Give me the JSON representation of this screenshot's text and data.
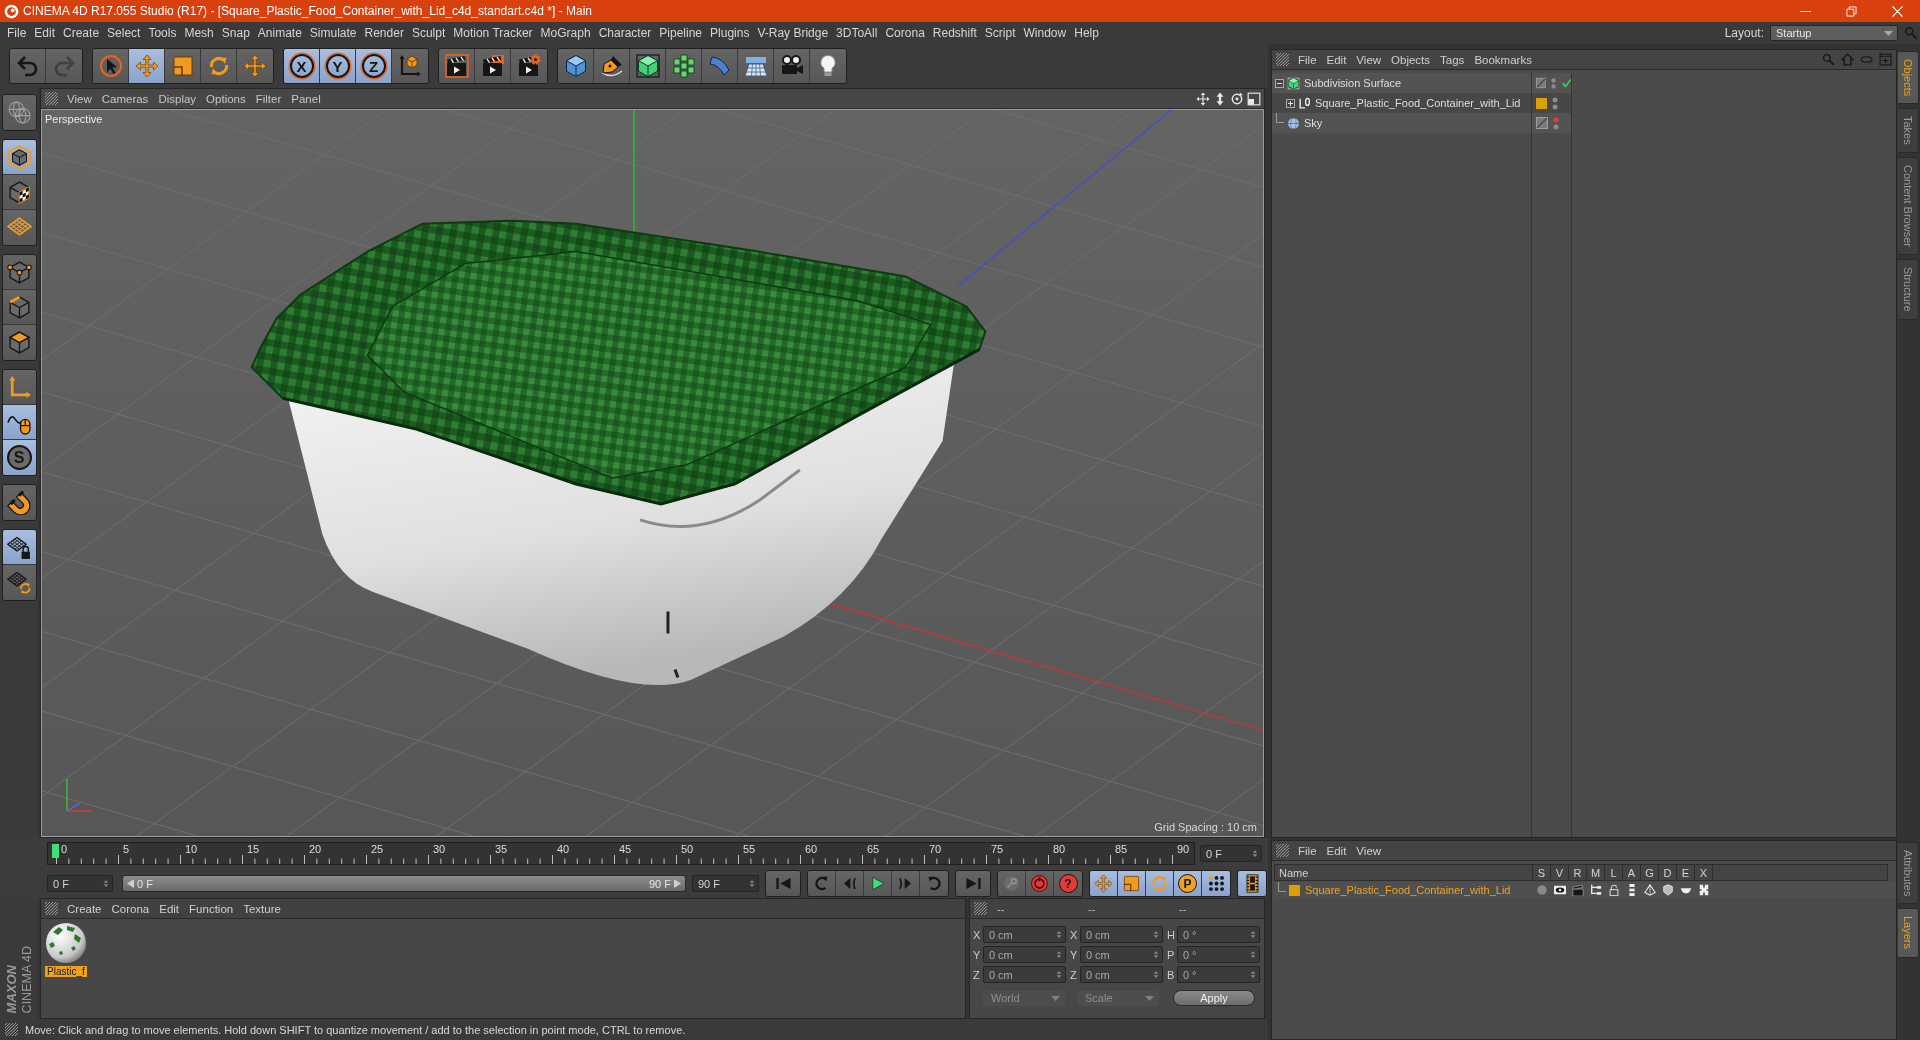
{
  "window": {
    "title": "CINEMA 4D R17.055 Studio (R17) - [Square_Plastic_Food_Container_with_Lid_c4d_standart.c4d *] - Main"
  },
  "menu_bar": {
    "items": [
      "File",
      "Edit",
      "Create",
      "Select",
      "Tools",
      "Mesh",
      "Snap",
      "Animate",
      "Simulate",
      "Render",
      "Sculpt",
      "Motion Tracker",
      "MoGraph",
      "Character",
      "Pipeline",
      "Plugins",
      "V-Ray Bridge",
      "3DToAll",
      "Corona",
      "Redshift",
      "Script",
      "Window",
      "Help"
    ],
    "layout_label": "Layout:",
    "layout_value": "Startup"
  },
  "toolbar": [
    [
      {
        "kind": "undo",
        "active": false,
        "disabled": false
      },
      {
        "kind": "redo",
        "active": false,
        "disabled": true
      }
    ],
    [
      {
        "kind": "select",
        "active": false,
        "disabled": false
      },
      {
        "kind": "move",
        "active": true,
        "disabled": false
      },
      {
        "kind": "scale",
        "active": false,
        "disabled": false
      },
      {
        "kind": "rotate",
        "active": false,
        "disabled": false
      },
      {
        "kind": "recent",
        "active": false,
        "disabled": false
      }
    ],
    [
      {
        "kind": "axis",
        "label": "X",
        "active": true,
        "disabled": false
      },
      {
        "kind": "axis",
        "label": "Y",
        "active": true,
        "disabled": false
      },
      {
        "kind": "axis",
        "label": "Z",
        "active": true,
        "disabled": false
      },
      {
        "kind": "coords",
        "active": false,
        "disabled": false
      }
    ],
    [
      {
        "kind": "render_view",
        "active": false,
        "disabled": false
      },
      {
        "kind": "render_picture",
        "active": false,
        "disabled": false
      },
      {
        "kind": "render_settings",
        "active": false,
        "disabled": false
      }
    ],
    [
      {
        "kind": "cube",
        "active": false,
        "disabled": false
      },
      {
        "kind": "pen",
        "active": false,
        "disabled": false
      },
      {
        "kind": "subdivision",
        "active": false,
        "disabled": false
      },
      {
        "kind": "cloner",
        "active": false,
        "disabled": false
      },
      {
        "kind": "bend",
        "active": false,
        "disabled": false
      },
      {
        "kind": "floor",
        "active": false,
        "disabled": false
      },
      {
        "kind": "camera",
        "active": false,
        "disabled": false
      },
      {
        "kind": "light",
        "active": false,
        "disabled": false
      }
    ]
  ],
  "mode_toolbar": [
    [
      {
        "kind": "make_editable",
        "active": false
      }
    ],
    [
      {
        "kind": "model",
        "active": true
      },
      {
        "kind": "texture",
        "active": false
      },
      {
        "kind": "workplane",
        "active": false
      }
    ],
    [
      {
        "kind": "points",
        "active": false
      },
      {
        "kind": "edges",
        "active": false
      },
      {
        "kind": "polygons",
        "active": false
      }
    ],
    [
      {
        "kind": "axis_mode",
        "active": false
      },
      {
        "kind": "tweak",
        "active": true
      },
      {
        "kind": "solo",
        "label": "S",
        "active": true
      }
    ],
    [
      {
        "kind": "snap",
        "active": false
      }
    ],
    [
      {
        "kind": "workplane_lock",
        "active": true
      },
      {
        "kind": "workplane_rotate",
        "active": false
      }
    ]
  ],
  "viewport": {
    "menu": [
      "View",
      "Cameras",
      "Display",
      "Options",
      "Filter",
      "Panel"
    ],
    "camera": "Perspective",
    "grid_spacing": "Grid Spacing : 10 cm"
  },
  "timeline": {
    "ruler_labels": [
      "0",
      "5",
      "10",
      "15",
      "20",
      "25",
      "30",
      "35",
      "40",
      "45",
      "50",
      "55",
      "60",
      "65",
      "70",
      "75",
      "80",
      "85",
      "90"
    ],
    "playhead": {
      "level": 0
    },
    "current_frame": "0 F",
    "start_frame": "0 F",
    "range": {
      "start": "0 F",
      "end": "90 F",
      "level": 1
    },
    "end_frame": "90 F",
    "transport": [
      [
        {
          "kind": "first"
        }
      ],
      [
        {
          "kind": "prev_key"
        },
        {
          "kind": "prev_frame"
        },
        {
          "kind": "play"
        },
        {
          "kind": "next_frame"
        },
        {
          "kind": "next_key"
        }
      ],
      [
        {
          "kind": "last"
        }
      ]
    ],
    "record": [
      {
        "kind": "autokey",
        "disabled": true
      },
      {
        "kind": "record",
        "disabled": false
      },
      {
        "kind": "key_help",
        "label": "?",
        "disabled": false
      }
    ],
    "key_filters": [
      {
        "kind": "key_position",
        "active": true
      },
      {
        "kind": "key_scale",
        "active": true
      },
      {
        "kind": "key_rotation",
        "active": true
      },
      {
        "kind": "key_parameter",
        "label": "P",
        "active": true
      },
      {
        "kind": "key_pla",
        "active": true
      }
    ],
    "timeline_button": {
      "active": true
    }
  },
  "brand": {
    "maker": "MAXON",
    "product": "CINEMA 4D"
  },
  "materials": {
    "menu": [
      "Create",
      "Corona",
      "Edit",
      "Function",
      "Texture"
    ],
    "items": [
      {
        "name": "Plastic_f",
        "selected": true
      }
    ]
  },
  "coordinates": {
    "headers": [
      "--",
      "--",
      "--"
    ],
    "rows": [
      [
        {
          "label": "X",
          "value": "0 cm"
        },
        {
          "label": "X",
          "value": "0 cm"
        },
        {
          "label": "H",
          "value": "0 °"
        }
      ],
      [
        {
          "label": "Y",
          "value": "0 cm"
        },
        {
          "label": "Y",
          "value": "0 cm"
        },
        {
          "label": "P",
          "value": "0 °"
        }
      ],
      [
        {
          "label": "Z",
          "value": "0 cm"
        },
        {
          "label": "Z",
          "value": "0 cm"
        },
        {
          "label": "B",
          "value": "0 °"
        }
      ]
    ],
    "dropdowns": [
      {
        "value": "World",
        "disabled": true
      },
      {
        "value": "Scale",
        "disabled": true
      }
    ],
    "apply": "Apply"
  },
  "status_bar": {
    "text": "Move: Click and drag to move elements. Hold down SHIFT to quantize movement / add to the selection in point mode, CTRL to remove."
  },
  "objects": {
    "menu": [
      "File",
      "Edit",
      "View",
      "Objects",
      "Tags",
      "Bookmarks"
    ],
    "tree": [
      {
        "name": "Subdivision Surface",
        "kind": "subdivision",
        "expanded": true,
        "hidden_in_editor": false,
        "hidden_in_render": false,
        "enabled": true,
        "children": [
          {
            "name": "Square_Plastic_Food_Container_with_Lid",
            "kind": "null",
            "expanded": false,
            "color": "#d9a000",
            "hidden_in_editor": false,
            "hidden_in_render": false,
            "enabled": false
          }
        ]
      },
      {
        "name": "Sky",
        "kind": "sky",
        "hidden_in_editor": true,
        "hidden_in_render": false,
        "enabled": false
      }
    ]
  },
  "layers": {
    "menu": [
      "File",
      "Edit",
      "View"
    ],
    "columns": [
      "Name",
      "S",
      "V",
      "R",
      "M",
      "L",
      "A",
      "G",
      "D",
      "E",
      "X"
    ],
    "rows": [
      {
        "name": "Square_Plastic_Food_Container_with_Lid",
        "color": "#d9a000",
        "selected": true
      }
    ]
  },
  "dock_tabs": {
    "top": [
      {
        "label": "Objects",
        "selected": true
      },
      {
        "label": "Takes",
        "selected": false
      },
      {
        "label": "Content Browser",
        "selected": false
      },
      {
        "label": "Structure",
        "selected": false
      }
    ],
    "bottom": [
      {
        "label": "Attributes",
        "selected": false
      },
      {
        "label": "Layers",
        "selected": true
      }
    ]
  }
}
